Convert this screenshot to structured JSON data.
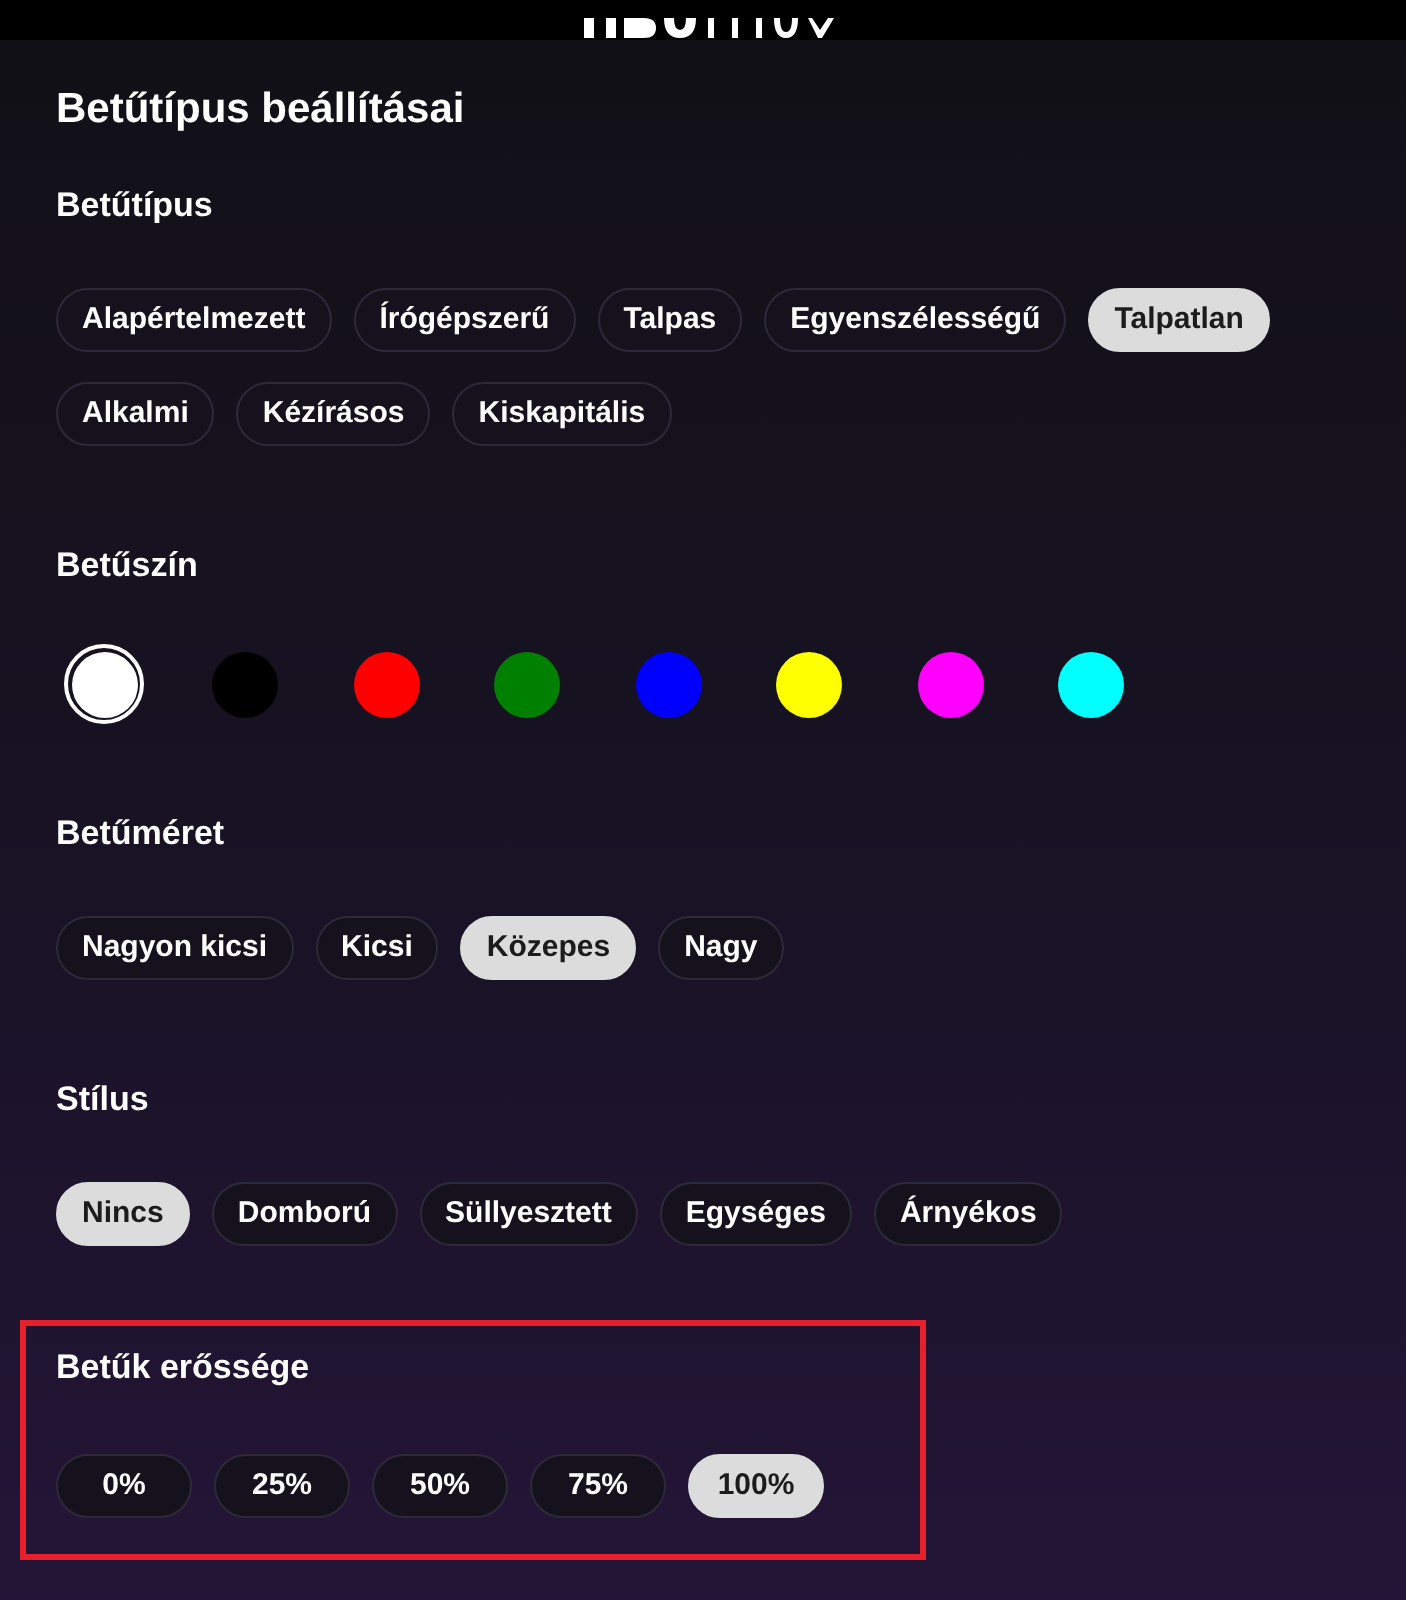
{
  "title": "Betűtípus beállításai",
  "sections": [
    {
      "kind": "chips",
      "label": "Betűtípus",
      "highlighted": false,
      "options": [
        {
          "label": "Alapértelmezett",
          "selected": false
        },
        {
          "label": "Írógépszerű",
          "selected": false
        },
        {
          "label": "Talpas",
          "selected": false
        },
        {
          "label": "Egyenszélességű",
          "selected": false
        },
        {
          "label": "Talpatlan",
          "selected": true
        },
        {
          "label": "Alkalmi",
          "selected": false
        },
        {
          "label": "Kézírásos",
          "selected": false
        },
        {
          "label": "Kiskapitális",
          "selected": false
        }
      ]
    },
    {
      "kind": "swatches",
      "label": "Betűszín",
      "highlighted": false,
      "options": [
        {
          "color": "#ffffff",
          "selected": true
        },
        {
          "color": "#000000",
          "selected": false
        },
        {
          "color": "#ff0000",
          "selected": false
        },
        {
          "color": "#008000",
          "selected": false
        },
        {
          "color": "#0000ff",
          "selected": false
        },
        {
          "color": "#ffff00",
          "selected": false
        },
        {
          "color": "#ff00ff",
          "selected": false
        },
        {
          "color": "#00ffff",
          "selected": false
        }
      ]
    },
    {
      "kind": "chips",
      "label": "Betűméret",
      "highlighted": false,
      "options": [
        {
          "label": "Nagyon kicsi",
          "selected": false
        },
        {
          "label": "Kicsi",
          "selected": false
        },
        {
          "label": "Közepes",
          "selected": true
        },
        {
          "label": "Nagy",
          "selected": false
        }
      ]
    },
    {
      "kind": "chips",
      "label": "Stílus",
      "highlighted": false,
      "options": [
        {
          "label": "Nincs",
          "selected": true
        },
        {
          "label": "Domború",
          "selected": false
        },
        {
          "label": "Süllyesztett",
          "selected": false
        },
        {
          "label": "Egységes",
          "selected": false
        },
        {
          "label": "Árnyékos",
          "selected": false
        }
      ]
    },
    {
      "kind": "chips",
      "label": "Betűk erőssége",
      "highlighted": true,
      "options": [
        {
          "label": "0%",
          "selected": false
        },
        {
          "label": "25%",
          "selected": false
        },
        {
          "label": "50%",
          "selected": false
        },
        {
          "label": "75%",
          "selected": false
        },
        {
          "label": "100%",
          "selected": true
        }
      ]
    }
  ]
}
